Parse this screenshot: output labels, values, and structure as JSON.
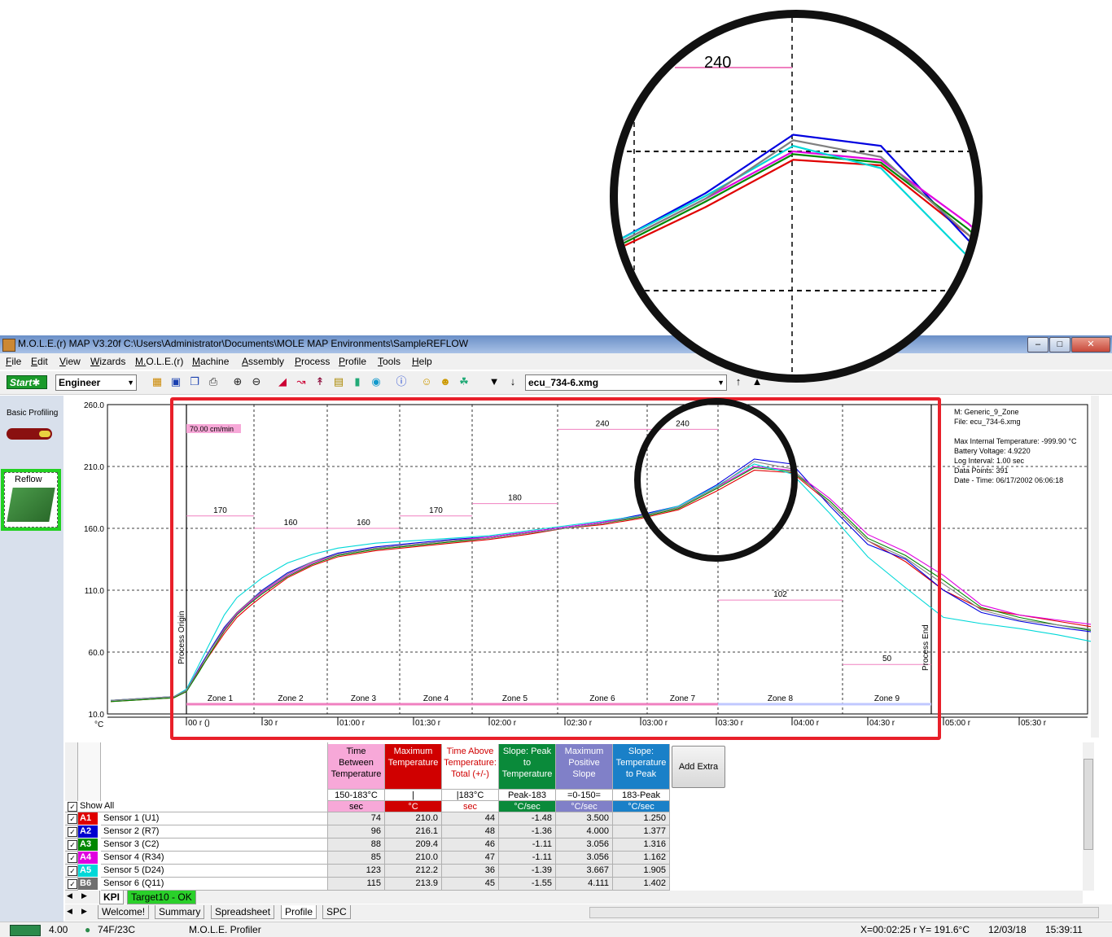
{
  "window": {
    "title": "M.O.L.E.(r) MAP V3.20f  C:\\Users\\Administrator\\Documents\\MOLE MAP Environments\\SampleREFLOW"
  },
  "menu": [
    "File",
    "Edit",
    "View",
    "Wizards",
    "M.O.L.E.(r)",
    "Machine",
    "Assembly",
    "Process",
    "Profile",
    "Tools",
    "Help"
  ],
  "toolbar": {
    "start_label": "Start",
    "role_value": "Engineer",
    "file_value": "ecu_734-6.xmg"
  },
  "left_panel": {
    "basic_profiling": "Basic Profiling",
    "reflow": "Reflow"
  },
  "chart_info": {
    "machine": "M: Generic_9_Zone",
    "file": "File: ecu_734-6.xmg",
    "max_internal": "Max Internal Temperature: -999.90 °C",
    "battery": "Battery Voltage: 4.9220",
    "log_interval": "Log Interval: 1.00 sec",
    "data_points": "Data Points: 391",
    "date_time": "Date - Time: 06/17/2002 06:06:18",
    "conveyor_speed": "70.00 cm/min",
    "process_origin": "Process Origin",
    "process_end": "Process End",
    "unit": "°C"
  },
  "chart_data": {
    "type": "line",
    "ylim": [
      10,
      260
    ],
    "yticks": [
      "260.0",
      "210.0",
      "160.0",
      "110.0",
      "60.0",
      "10.0"
    ],
    "xticks": [
      "00 r ()",
      "30 r",
      "01:00 r",
      "01:30 r",
      "02:00 r",
      "02:30 r",
      "03:00 r",
      "03:30 r",
      "04:00 r",
      "04:30 r",
      "05:00 r",
      "05:30 r"
    ],
    "zones": [
      {
        "name": "Zone 1",
        "setpoint": "170"
      },
      {
        "name": "Zone 2",
        "setpoint": "160"
      },
      {
        "name": "Zone 3",
        "setpoint": "160"
      },
      {
        "name": "Zone 4",
        "setpoint": "170"
      },
      {
        "name": "Zone 5",
        "setpoint": "180"
      },
      {
        "name": "Zone 6",
        "setpoint": "240"
      },
      {
        "name": "Zone 7",
        "setpoint": "240"
      },
      {
        "name": "Zone 8",
        "setpoint": "102"
      },
      {
        "name": "Zone 9",
        "setpoint": "50"
      }
    ],
    "x_seconds": [
      -30,
      -5,
      0,
      5,
      10,
      15,
      20,
      25,
      30,
      40,
      50,
      60,
      75,
      90,
      105,
      120,
      135,
      150,
      165,
      180,
      195,
      210,
      225,
      240,
      255,
      270,
      285,
      300,
      315,
      330,
      345,
      360,
      375,
      390
    ],
    "series": [
      {
        "name": "Sensor 1 (U1)",
        "color": "#e00000",
        "values": [
          20,
          23,
          28,
          45,
          60,
          75,
          88,
          97,
          105,
          120,
          130,
          137,
          142,
          145,
          148,
          151,
          155,
          160,
          163,
          168,
          175,
          190,
          207,
          205,
          180,
          150,
          133,
          110,
          95,
          90,
          85,
          80,
          74,
          68
        ]
      },
      {
        "name": "Sensor 2 (R7)",
        "color": "#0000e0",
        "values": [
          21,
          24,
          29,
          47,
          64,
          80,
          92,
          101,
          110,
          124,
          133,
          140,
          145,
          148,
          151,
          153,
          157,
          161,
          165,
          171,
          178,
          195,
          216,
          212,
          178,
          147,
          135,
          110,
          92,
          85,
          80,
          76,
          70,
          63
        ]
      },
      {
        "name": "Sensor 3 (C2)",
        "color": "#008800",
        "values": [
          20,
          23,
          28,
          44,
          61,
          77,
          90,
          99,
          107,
          121,
          131,
          138,
          143,
          146,
          149,
          152,
          156,
          160,
          164,
          169,
          176,
          192,
          209,
          206,
          182,
          152,
          138,
          118,
          96,
          88,
          82,
          77,
          72,
          66
        ]
      },
      {
        "name": "Sensor 4 (R34)",
        "color": "#e000e0",
        "values": [
          21,
          24,
          29,
          46,
          63,
          78,
          91,
          100,
          108,
          122,
          132,
          139,
          144,
          147,
          150,
          153,
          157,
          161,
          165,
          170,
          177,
          193,
          210,
          207,
          184,
          155,
          141,
          122,
          98,
          90,
          86,
          82,
          76,
          70
        ]
      },
      {
        "name": "Sensor 5 (D24)",
        "color": "#00d8d8",
        "values": [
          21,
          24,
          30,
          50,
          70,
          90,
          104,
          112,
          120,
          132,
          139,
          144,
          148,
          150,
          152,
          154,
          158,
          162,
          166,
          170,
          178,
          194,
          212,
          204,
          172,
          137,
          112,
          88,
          83,
          79,
          74,
          68,
          62,
          56
        ]
      },
      {
        "name": "Sensor 6 (Q11)",
        "color": "#808080",
        "values": [
          21,
          24,
          29,
          46,
          63,
          79,
          92,
          101,
          109,
          123,
          133,
          139,
          144,
          147,
          150,
          152,
          156,
          160,
          164,
          170,
          177,
          193,
          214,
          208,
          180,
          150,
          136,
          115,
          94,
          86,
          82,
          78,
          72,
          66
        ]
      }
    ]
  },
  "table": {
    "columns": [
      {
        "title": "Time Between Temperature",
        "range": "150-183°C",
        "unit": "sec",
        "bg": "#f7a8d8",
        "fg": "#000"
      },
      {
        "title": "Maximum Temperature",
        "range": "|",
        "unit": "°C",
        "bg": "#d00000",
        "fg": "#fff"
      },
      {
        "title": "Time Above Temperature: Total (+/-)",
        "range": "|183°C",
        "unit": "sec",
        "bg": "#ffffff",
        "fg": "#d00000"
      },
      {
        "title": "Slope: Peak to Temperature",
        "range": "Peak-183",
        "unit": "°C/sec",
        "bg": "#0a8a3a",
        "fg": "#fff"
      },
      {
        "title": "Maximum Positive Slope",
        "range": "=0-150=",
        "unit": "°C/sec",
        "bg": "#8080c8",
        "fg": "#fff"
      },
      {
        "title": "Slope: Temperature to Peak",
        "range": "183-Peak",
        "unit": "°C/sec",
        "bg": "#1a80c8",
        "fg": "#fff"
      }
    ],
    "add_extra": "Add Extra",
    "show_all": "Show All",
    "rows": [
      {
        "tag": "A1",
        "tag_color": "#e00000",
        "name": "Sensor 1 (U1)",
        "vals": [
          "74",
          "210.0",
          "44",
          "-1.48",
          "3.500",
          "1.250"
        ]
      },
      {
        "tag": "A2",
        "tag_color": "#0000d0",
        "name": "Sensor 2 (R7)",
        "vals": [
          "96",
          "216.1",
          "48",
          "-1.36",
          "4.000",
          "1.377"
        ]
      },
      {
        "tag": "A3",
        "tag_color": "#008800",
        "name": "Sensor 3 (C2)",
        "vals": [
          "88",
          "209.4",
          "46",
          "-1.11",
          "3.056",
          "1.316"
        ]
      },
      {
        "tag": "A4",
        "tag_color": "#e000e0",
        "name": "Sensor 4 (R34)",
        "vals": [
          "85",
          "210.0",
          "47",
          "-1.11",
          "3.056",
          "1.162"
        ]
      },
      {
        "tag": "A5",
        "tag_color": "#00d8d8",
        "name": "Sensor 5 (D24)",
        "vals": [
          "123",
          "212.2",
          "36",
          "-1.39",
          "3.667",
          "1.905"
        ]
      },
      {
        "tag": "B6",
        "tag_color": "#707070",
        "name": "Sensor 6 (Q11)",
        "vals": [
          "115",
          "213.9",
          "45",
          "-1.55",
          "4.111",
          "1.402"
        ]
      }
    ]
  },
  "inner_tabs": [
    "KPI",
    "Target10 - OK"
  ],
  "main_tabs": [
    "Welcome!",
    "Summary",
    "Spreadsheet",
    "Profile",
    "SPC"
  ],
  "status": {
    "battery": "4.00",
    "temp": "74F/23C",
    "app": "M.O.L.E. Profiler",
    "coords": "X=00:02:25 r Y= 191.6°C",
    "date": "12/03/18",
    "time": "15:39:11"
  },
  "zoom": {
    "setpoint": "240"
  }
}
